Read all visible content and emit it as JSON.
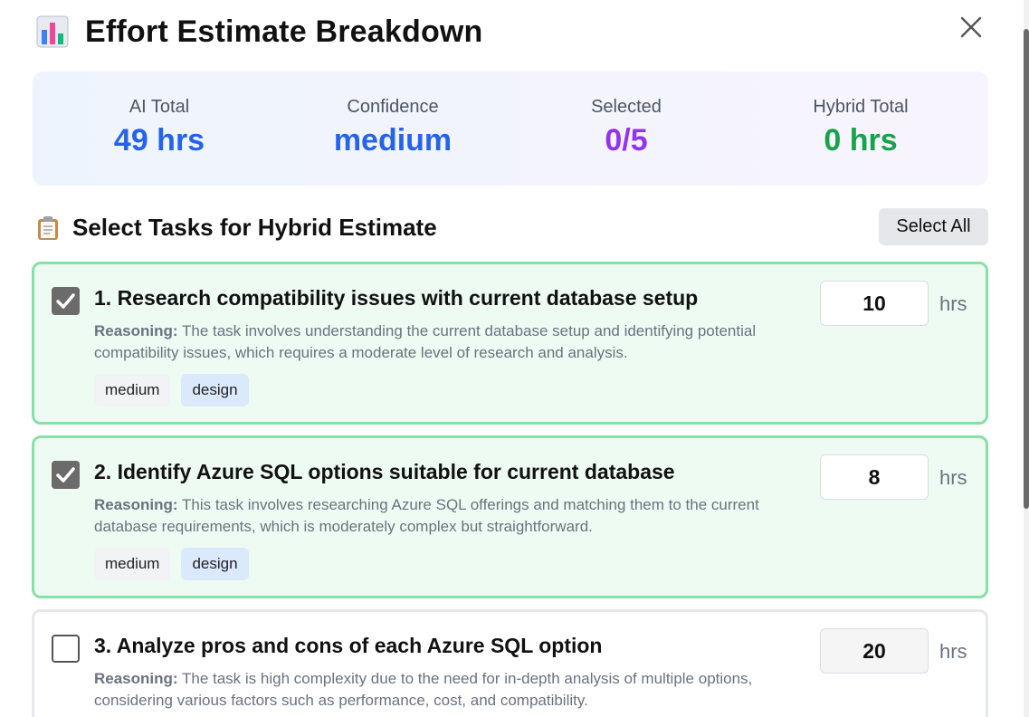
{
  "header": {
    "title": "Effort Estimate Breakdown",
    "icon": "bar-chart-icon",
    "close_icon": "close-icon"
  },
  "summary": {
    "ai_total": {
      "label": "AI Total",
      "value": "49 hrs",
      "color": "#2563eb"
    },
    "confidence": {
      "label": "Confidence",
      "value": "medium",
      "color": "#2563eb"
    },
    "selected": {
      "label": "Selected",
      "value": "0/5",
      "color": "#9333ea"
    },
    "hybrid_total": {
      "label": "Hybrid Total",
      "value": "0 hrs",
      "color": "#16a34a"
    }
  },
  "section": {
    "title": "Select Tasks for Hybrid Estimate",
    "icon": "clipboard-icon",
    "select_all_label": "Select All"
  },
  "tasks": [
    {
      "title": "1. Research compatibility issues with current database setup",
      "reasoning_label": "Reasoning:",
      "reasoning": "The task involves understanding the current database setup and identifying potential compatibility issues, which requires a moderate level of research and analysis.",
      "complexity": "medium",
      "category": "design",
      "hours": "10",
      "hours_unit": "hrs",
      "checked": true
    },
    {
      "title": "2. Identify Azure SQL options suitable for current database",
      "reasoning_label": "Reasoning:",
      "reasoning": "This task involves researching Azure SQL offerings and matching them to the current database requirements, which is moderately complex but straightforward.",
      "complexity": "medium",
      "category": "design",
      "hours": "8",
      "hours_unit": "hrs",
      "checked": true
    },
    {
      "title": "3. Analyze pros and cons of each Azure SQL option",
      "reasoning_label": "Reasoning:",
      "reasoning": "The task is high complexity due to the need for in-depth analysis of multiple options, considering various factors such as performance, cost, and compatibility.",
      "hours": "20",
      "hours_unit": "hrs",
      "checked": false
    }
  ],
  "colors": {
    "selected_border": "#86e0a8",
    "selected_background": "#eefbf3",
    "category_tag": "#dbe9fd"
  }
}
